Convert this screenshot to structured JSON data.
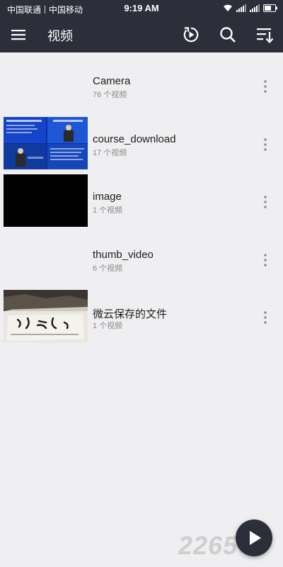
{
  "status_bar": {
    "carrier_1": "中国联通",
    "carrier_2": "中国移动",
    "time": "9:19 AM",
    "icons": [
      "wifi-icon",
      "signal-icon",
      "signal-icon",
      "battery-icon"
    ]
  },
  "app_bar": {
    "title": "视频",
    "icons": [
      "menu-icon",
      "recent-play-icon",
      "search-icon",
      "sort-icon"
    ]
  },
  "folders": [
    {
      "name": "Camera",
      "count": "76 个视频",
      "thumbnail": "none"
    },
    {
      "name": "course_download",
      "count": "17 个视频",
      "thumbnail": "lecture-video"
    },
    {
      "name": "image",
      "count": "1 个视频",
      "thumbnail": "black-frame"
    },
    {
      "name": "thumb_video",
      "count": "6 个视频",
      "thumbnail": "none"
    },
    {
      "name": "微云保存的文件",
      "count": "1 个视频",
      "thumbnail": "calligraphy-video"
    }
  ],
  "fab": {
    "icon": "play-icon"
  },
  "watermark": {
    "text": "2265"
  },
  "colors": {
    "app_bar": "#2c2f3a",
    "background": "#efeff1",
    "title_text": "#1e1e1e",
    "secondary_text": "#8a8a8a"
  }
}
